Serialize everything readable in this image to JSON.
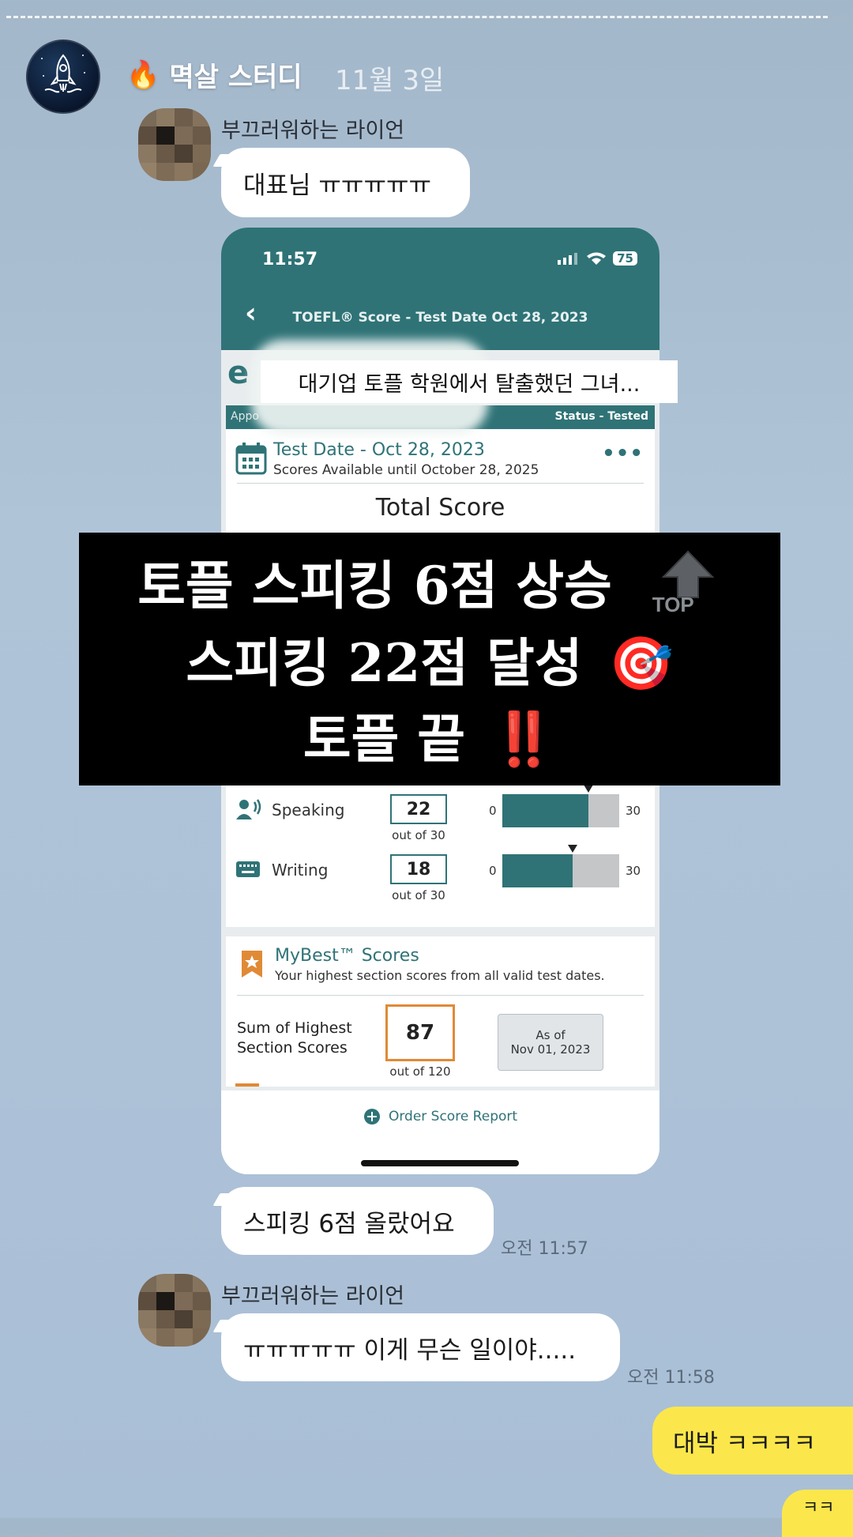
{
  "story": {
    "group_name": "멱살 스터디",
    "date": "11월 3일",
    "fire_emoji": "🔥"
  },
  "chat": {
    "msg1": {
      "sender": "부끄러워하는 라이언",
      "text": "대표님 ㅠㅠㅠㅠㅠ"
    },
    "msg2": {
      "text": "스피킹 6점 올랐어요",
      "time": "오전 11:57"
    },
    "msg3": {
      "sender": "부끄러워하는 라이언",
      "text": "ㅠㅠㅠㅠㅠ 이게 무슨 일이야.....",
      "time": "오전 11:58"
    },
    "msg4": {
      "text": "대박 ㅋㅋㅋㅋ"
    },
    "msg5": {
      "text": "ㅋㅋ"
    }
  },
  "screenshot": {
    "status_time": "11:57",
    "battery": "75",
    "nav_title": "TOEFL® Score - Test Date Oct 28, 2023",
    "caption": "대기업 토플 학원에서 탈출했던 그녀...",
    "table_left": "Appo",
    "table_right": "Status - Tested",
    "test_date": "Test Date - Oct 28, 2023",
    "scores_available": "Scores Available until October 28, 2025",
    "total_score_label": "Total Score",
    "sections": [
      {
        "name": "Speaking",
        "score": "22",
        "out_of": "out of 30",
        "min": "0",
        "max": "30",
        "value": 22
      },
      {
        "name": "Writing",
        "score": "18",
        "out_of": "out of 30",
        "min": "0",
        "max": "30",
        "value": 18
      }
    ],
    "mybest_title": "MyBest™ Scores",
    "mybest_sub": "Your highest section scores from all valid test dates.",
    "sum_label_1": "Sum of Highest",
    "sum_label_2": "Section Scores",
    "sum_score": "87",
    "sum_out_of": "out of 120",
    "as_of_1": "As of",
    "as_of_2": "Nov 01, 2023",
    "order_label": "Order Score Report"
  },
  "overlay": {
    "line1": "토플 스피킹 6점 상승",
    "line2": "스피킹 22점 달성",
    "line3": "토플 끝",
    "top_label": "TOP",
    "target_emoji": "🎯",
    "exclaim_emoji": "‼️"
  },
  "colors": {
    "teal": "#2f7377",
    "yellow_bubble": "#fbe74b",
    "best_orange": "#e08a36"
  }
}
